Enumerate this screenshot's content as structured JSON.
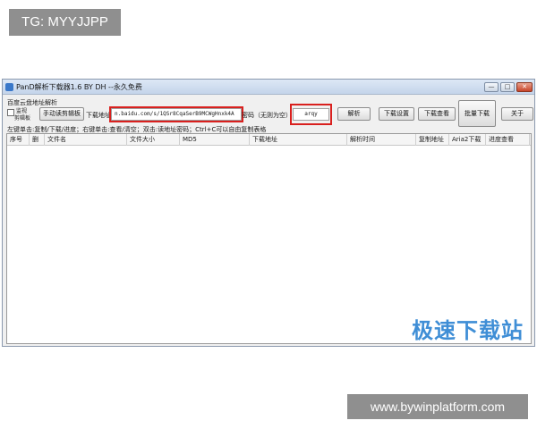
{
  "watermarks": {
    "top": "TG: MYYJJPP",
    "bottom": "www.bywinplatform.com"
  },
  "window": {
    "title": "PanD解析下载器1.6 BY DH  --永久免费",
    "minimize_label": "—",
    "maximize_label": "□",
    "close_label": "✕"
  },
  "toolbar": {
    "section_label": "百度云盘地址解析",
    "monitor_checkbox_line1": "监视",
    "monitor_checkbox_line2": "剪辑板",
    "manual_read_button": "手动读剪辑板",
    "url_label": "下载地址",
    "url_value": "n.baidu.com/s/1QSr8CqaSerB9MCWgHnxk4A",
    "password_label": "密码（无则为空）",
    "password_value": "arqy",
    "parse_button": "解析",
    "download_settings_button": "下载设置",
    "download_view_button": "下载查看",
    "batch_download_button": "批量下载",
    "about_button": "关于"
  },
  "hint": "左键单击:复制/下载/进度；右键单击:查看/清空；双击:读地址密码；Ctrl+C可以自由复制表格",
  "table": {
    "columns": [
      "序号",
      "删",
      "文件名",
      "文件大小",
      "MD5",
      "下载地址",
      "解析时间",
      "复制地址",
      "Aria2下载",
      "进度查看"
    ]
  },
  "logo": "极速下载站",
  "colors": {
    "highlight": "#d9201e",
    "logo": "#3f8ed6",
    "watermark_bg": "#8f8f8f"
  }
}
